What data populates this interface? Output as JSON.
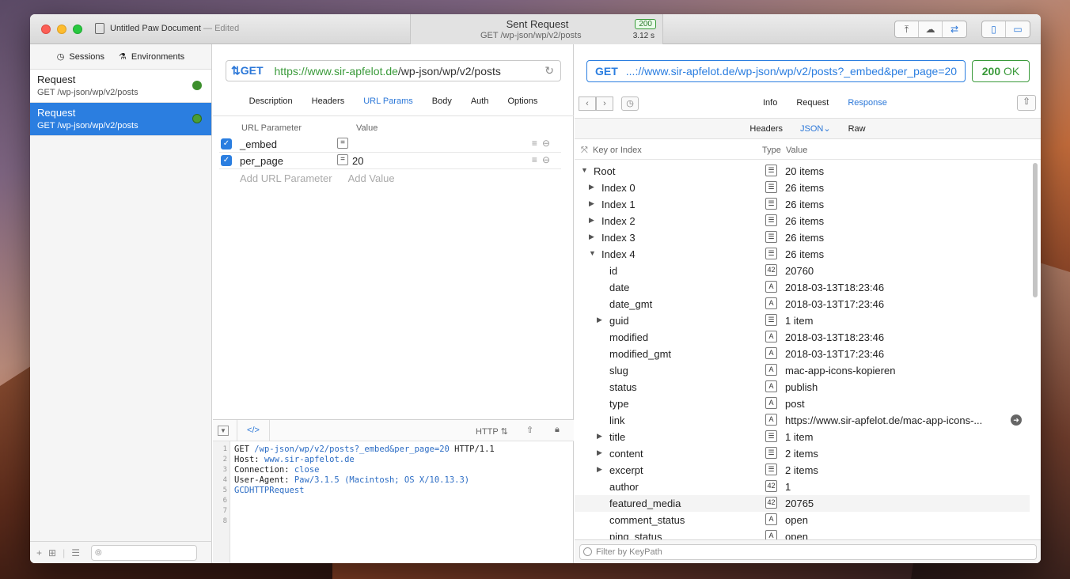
{
  "window": {
    "doc_title": "Untitled Paw Document",
    "doc_status": "— Edited"
  },
  "sent": {
    "title": "Sent Request",
    "subtitle": "GET /wp-json/wp/v2/posts",
    "status": "200",
    "time": "3.12 s"
  },
  "sidebar": {
    "tabs": [
      {
        "label": "Sessions",
        "icon": "clock-icon"
      },
      {
        "label": "Environments",
        "icon": "environments-icon"
      }
    ],
    "requests": [
      {
        "name": "Request",
        "path": "GET /wp-json/wp/v2/posts",
        "selected": false
      },
      {
        "name": "Request",
        "path": "GET /wp-json/wp/v2/posts",
        "selected": true
      }
    ]
  },
  "request": {
    "method": "GET",
    "url_host": "https://www.sir-apfelot.de",
    "url_path": "/wp-json/wp/v2/posts",
    "tabs": [
      "Description",
      "Headers",
      "URL Params",
      "Body",
      "Auth",
      "Options"
    ],
    "active_tab": "URL Params",
    "params_header": {
      "name": "URL Parameter",
      "value": "Value"
    },
    "params": [
      {
        "name": "_embed",
        "value": ""
      },
      {
        "name": "per_page",
        "value": "20"
      }
    ],
    "add_param": "Add URL Parameter",
    "add_value": "Add Value",
    "code_format": "HTTP",
    "code_lines": [
      {
        "n": "1",
        "a": "GET ",
        "b": "/wp-json/wp/v2/posts?_embed&per_page=20",
        "c": " HTTP/1.1"
      },
      {
        "n": "2",
        "a": "Host: ",
        "b": "www.sir-apfelot.de",
        "c": ""
      },
      {
        "n": "3",
        "a": "Connection: ",
        "b": "close",
        "c": ""
      },
      {
        "n": "4",
        "a": "User-Agent: ",
        "b": "Paw/3.1.5 (Macintosh; OS X/10.13.3)",
        "c": ""
      },
      {
        "n": "5",
        "a": "",
        "b": "GCDHTTPRequest",
        "c": ""
      },
      {
        "n": "6",
        "a": "",
        "b": "",
        "c": ""
      },
      {
        "n": "7",
        "a": "",
        "b": "",
        "c": ""
      },
      {
        "n": "8",
        "a": "",
        "b": "",
        "c": ""
      }
    ]
  },
  "response": {
    "method": "GET",
    "url": "...://www.sir-apfelot.de/wp-json/wp/v2/posts?_embed&per_page=20",
    "status_code": "200",
    "status_text": "OK",
    "tabs": [
      "Info",
      "Request",
      "Response"
    ],
    "active_tab": "Response",
    "subtabs": [
      "Headers",
      "JSON",
      "Raw"
    ],
    "active_subtab": "JSON",
    "columns": {
      "key": "Key or Index",
      "type": "Type",
      "value": "Value"
    },
    "rows": [
      {
        "key": "Root",
        "level": 0,
        "arrow": "open",
        "type": "list",
        "value": "20 items"
      },
      {
        "key": "Index 0",
        "level": 1,
        "arrow": "closed",
        "type": "list",
        "value": "26 items"
      },
      {
        "key": "Index 1",
        "level": 1,
        "arrow": "closed",
        "type": "list",
        "value": "26 items"
      },
      {
        "key": "Index 2",
        "level": 1,
        "arrow": "closed",
        "type": "list",
        "value": "26 items"
      },
      {
        "key": "Index 3",
        "level": 1,
        "arrow": "closed",
        "type": "list",
        "value": "26 items"
      },
      {
        "key": "Index 4",
        "level": 1,
        "arrow": "open",
        "type": "list",
        "value": "26 items"
      },
      {
        "key": "id",
        "level": 2,
        "arrow": "",
        "type": "42",
        "value": "20760"
      },
      {
        "key": "date",
        "level": 2,
        "arrow": "",
        "type": "A",
        "value": "2018-03-13T18:23:46"
      },
      {
        "key": "date_gmt",
        "level": 2,
        "arrow": "",
        "type": "A",
        "value": "2018-03-13T17:23:46"
      },
      {
        "key": "guid",
        "level": 2,
        "arrow": "closed",
        "type": "list",
        "value": "1 item"
      },
      {
        "key": "modified",
        "level": 2,
        "arrow": "",
        "type": "A",
        "value": "2018-03-13T18:23:46"
      },
      {
        "key": "modified_gmt",
        "level": 2,
        "arrow": "",
        "type": "A",
        "value": "2018-03-13T17:23:46"
      },
      {
        "key": "slug",
        "level": 2,
        "arrow": "",
        "type": "A",
        "value": "mac-app-icons-kopieren"
      },
      {
        "key": "status",
        "level": 2,
        "arrow": "",
        "type": "A",
        "value": "publish"
      },
      {
        "key": "type",
        "level": 2,
        "arrow": "",
        "type": "A",
        "value": "post"
      },
      {
        "key": "link",
        "level": 2,
        "arrow": "",
        "type": "A",
        "value": "https://www.sir-apfelot.de/mac-app-icons-...",
        "go": true
      },
      {
        "key": "title",
        "level": 2,
        "arrow": "closed",
        "type": "list",
        "value": "1 item"
      },
      {
        "key": "content",
        "level": 2,
        "arrow": "closed",
        "type": "list",
        "value": "2 items"
      },
      {
        "key": "excerpt",
        "level": 2,
        "arrow": "closed",
        "type": "list",
        "value": "2 items"
      },
      {
        "key": "author",
        "level": 2,
        "arrow": "",
        "type": "42",
        "value": "1"
      },
      {
        "key": "featured_media",
        "level": 2,
        "arrow": "",
        "type": "42",
        "value": "20765",
        "highlight": true
      },
      {
        "key": "comment_status",
        "level": 2,
        "arrow": "",
        "type": "A",
        "value": "open"
      },
      {
        "key": "ping_status",
        "level": 2,
        "arrow": "",
        "type": "A",
        "value": "open"
      }
    ],
    "filter_placeholder": "Filter by KeyPath"
  }
}
